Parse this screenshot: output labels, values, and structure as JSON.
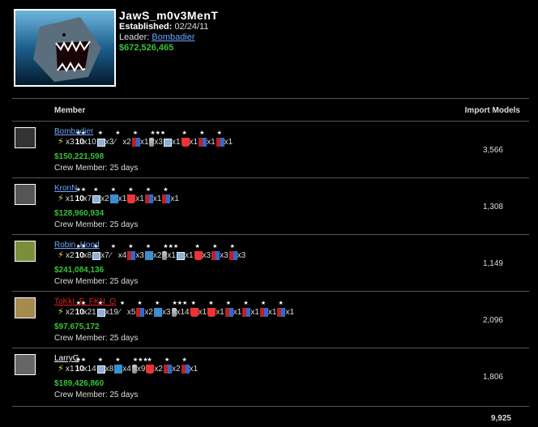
{
  "crew": {
    "name": "JawS_m0v3MenT",
    "established_label": "Established:",
    "established": "02/24/11",
    "leader_label": "Leader:",
    "leader": "Bombadier",
    "money": "$672,526,465"
  },
  "table": {
    "col_member": "Member",
    "col_models": "Import Models",
    "total_models": "9,925"
  },
  "members": [
    {
      "name": "Bombadier",
      "money": "$150,221,598",
      "days": "Crew Member: 25 days",
      "models": "3,566",
      "name_color": "#6aa7ff",
      "awards": [
        "bolt",
        "ten",
        "case",
        "knife",
        "flag",
        "pawn",
        "mail",
        "mug",
        "flag",
        "flag"
      ],
      "counts": [
        "x3",
        "x10",
        "x3",
        "x2",
        "x1",
        "x3",
        "x1",
        "x1",
        "x1",
        "x1"
      ]
    },
    {
      "name": "KronN",
      "money": "$128,960,934",
      "days": "Crew Member: 25 days",
      "models": "1,308",
      "name_color": "#6aa7ff",
      "awards": [
        "bolt",
        "ten",
        "case",
        "bot",
        "mug",
        "flag",
        "flag"
      ],
      "counts": [
        "x1",
        "x7",
        "x2",
        "x1",
        "x1",
        "x1",
        "x1"
      ]
    },
    {
      "name": "Robin_Hood",
      "money": "$241,084,136",
      "days": "Crew Member: 25 days",
      "models": "1,149",
      "name_color": "#6aa7ff",
      "awards": [
        "bolt",
        "ten",
        "case",
        "knife",
        "flag",
        "bot",
        "pawn",
        "mail",
        "mug",
        "flag",
        "flag"
      ],
      "counts": [
        "x2",
        "x8",
        "x7",
        "x4",
        "x3",
        "x2",
        "x1",
        "x1",
        "x3",
        "x3",
        "x3"
      ]
    },
    {
      "name": "ToKkI_E_FKN_O",
      "money": "$97,675,172",
      "days": "Crew Member: 25 days",
      "models": "2,096",
      "name_color": "#e02020",
      "awards": [
        "bolt",
        "ten",
        "case",
        "knife",
        "flag",
        "bot",
        "pawn",
        "mug",
        "mug",
        "flag",
        "flag",
        "flag",
        "flag"
      ],
      "counts": [
        "x2",
        "x21",
        "x19",
        "x5",
        "x2",
        "x3",
        "x14",
        "x1",
        "x1",
        "x1",
        "x1",
        "x1",
        "x1"
      ]
    },
    {
      "name": "LarryG",
      "money": "$189,426,860",
      "days": "Crew Member: 25 days",
      "models": "1,806",
      "name_color": "#ffffff",
      "awards": [
        "bolt",
        "ten",
        "case",
        "bot",
        "pawn",
        "mug",
        "flag",
        "flag"
      ],
      "counts": [
        "x1",
        "x14",
        "x8",
        "x4",
        "x9",
        "x2",
        "x2",
        "x1"
      ]
    }
  ]
}
